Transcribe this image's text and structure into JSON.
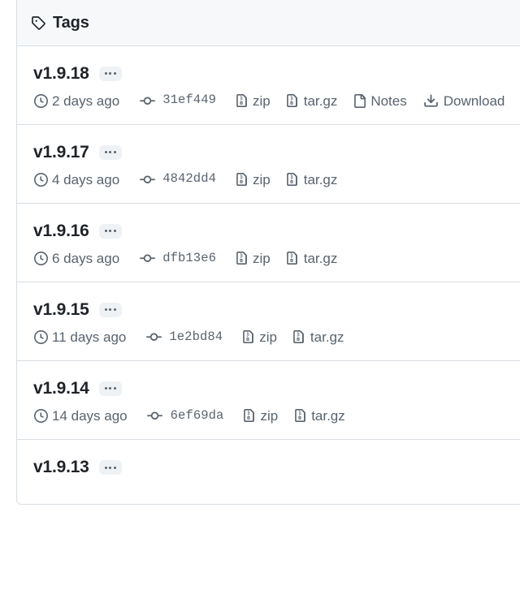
{
  "header": {
    "title": "Tags",
    "icon": "tag-icon"
  },
  "icons": {
    "clock": "clock-icon",
    "commit": "git-commit-icon",
    "zip": "file-zip-icon",
    "targz": "file-zip-icon",
    "notes": "file-icon",
    "download": "download-icon",
    "menu": "kebab-horizontal-icon"
  },
  "labels": {
    "zip": "zip",
    "targz": "tar.gz",
    "notes": "Notes",
    "download": "Download"
  },
  "colors": {
    "header_bg": "#f6f8fa",
    "border": "#d8dee4",
    "text": "#1f2328",
    "muted": "#59636e",
    "badge_bg": "#eff2f5"
  },
  "tags": [
    {
      "name": "v1.9.18",
      "age": "2 days ago",
      "commit": "31ef449",
      "has_notes": true,
      "has_download": true
    },
    {
      "name": "v1.9.17",
      "age": "4 days ago",
      "commit": "4842dd4",
      "has_notes": false,
      "has_download": false
    },
    {
      "name": "v1.9.16",
      "age": "6 days ago",
      "commit": "dfb13e6",
      "has_notes": false,
      "has_download": false
    },
    {
      "name": "v1.9.15",
      "age": "11 days ago",
      "commit": "1e2bd84",
      "has_notes": false,
      "has_download": false
    },
    {
      "name": "v1.9.14",
      "age": "14 days ago",
      "commit": "6ef69da",
      "has_notes": false,
      "has_download": false
    },
    {
      "name": "v1.9.13",
      "age": "",
      "commit": "",
      "has_notes": false,
      "has_download": false,
      "partial": true
    }
  ]
}
